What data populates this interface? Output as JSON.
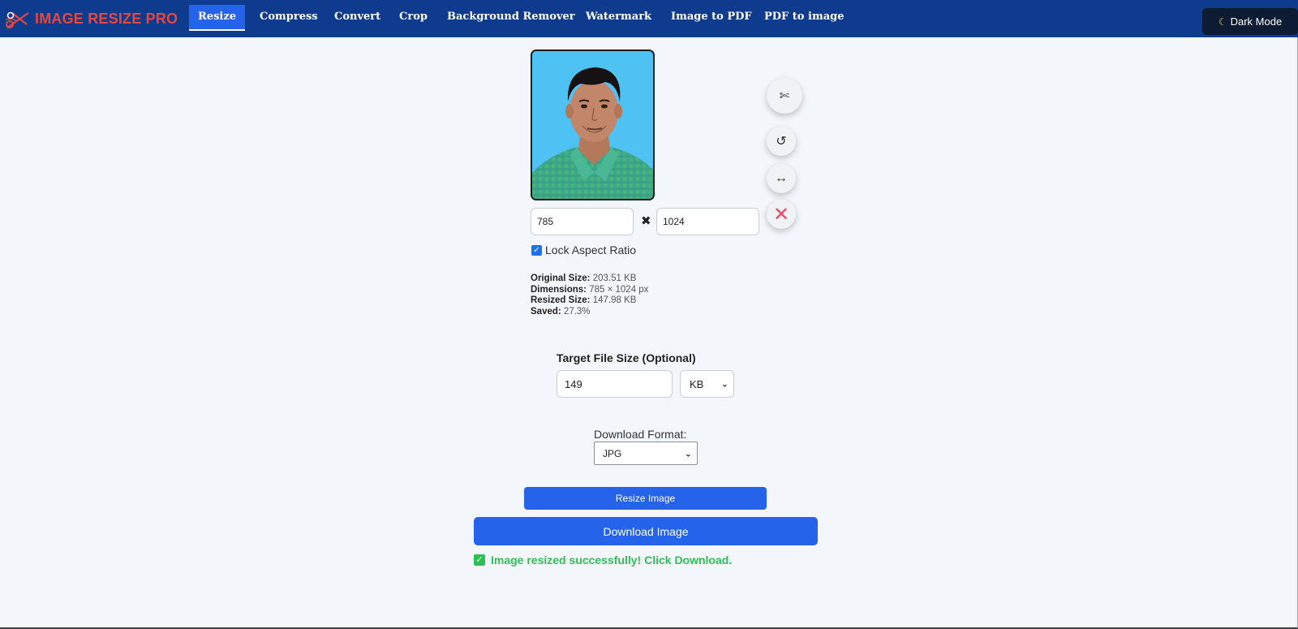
{
  "brand": {
    "name": "IMAGE RESIZE PRO",
    "logo_icon": "scissors-logo-icon"
  },
  "nav": {
    "items": [
      {
        "label": "Resize",
        "active": true
      },
      {
        "label": "Compress"
      },
      {
        "label": "Convert"
      },
      {
        "label": "Crop"
      },
      {
        "label": "Background Remover"
      },
      {
        "label": "Watermark"
      },
      {
        "label": "Image to PDF"
      },
      {
        "label": "PDF to image"
      }
    ],
    "dark_mode_label": "Dark Mode"
  },
  "tools": {
    "crop_icon": "scissors-icon",
    "rotate_icon": "rotate-icon",
    "flip_icon": "flip-horizontal-icon",
    "remove_icon": "close-icon"
  },
  "dimensions": {
    "width": "785",
    "height": "1024",
    "separator": "✖"
  },
  "lock_aspect": {
    "label": "Lock Aspect Ratio",
    "checked": true
  },
  "stats": {
    "original_label": "Original Size:",
    "original_value": "203.51 KB",
    "dimensions_label": "Dimensions:",
    "dimensions_value": "785 × 1024 px",
    "resized_label": "Resized Size:",
    "resized_value": "147.98 KB",
    "saved_label": "Saved:",
    "saved_value": "27.3%"
  },
  "target": {
    "label": "Target File Size (Optional)",
    "value": "149",
    "unit": "KB"
  },
  "format": {
    "label": "Download Format:",
    "value": "JPG"
  },
  "actions": {
    "resize_label": "Resize Image",
    "download_label": "Download Image"
  },
  "status": {
    "message": "Image resized successfully! Click Download."
  },
  "colors": {
    "nav_bg": "#0f3b8f",
    "accent": "#2563eb",
    "brand": "#e8463d",
    "success": "#2fbf55",
    "remove": "#e8476a"
  }
}
